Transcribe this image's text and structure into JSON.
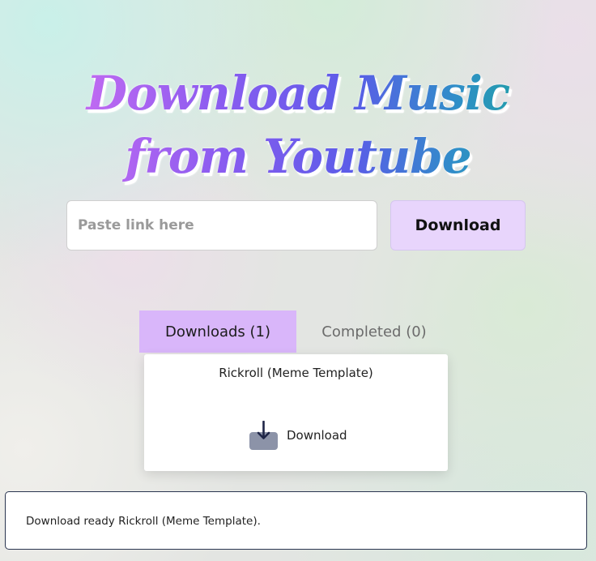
{
  "header": {
    "title": "Download Music from Youtube"
  },
  "search": {
    "placeholder": "Paste link here",
    "value": "",
    "button_label": "Download"
  },
  "tabs": [
    {
      "label": "Downloads (1)",
      "active": true
    },
    {
      "label": "Completed (0)",
      "active": false
    }
  ],
  "downloads": {
    "items": [
      {
        "title": "Rickroll (Meme Template)",
        "action_label": "Download",
        "icon": "download-icon"
      }
    ]
  },
  "status": {
    "message": "Download ready Rickroll (Meme Template)."
  },
  "colors": {
    "title_gradient": [
      "#d46ff2",
      "#8b5cf0",
      "#5b5ce8",
      "#2f8fc8",
      "#18a894"
    ],
    "button_bg": "#e8d5fc",
    "active_tab_bg": "#d9b6fa",
    "icon_tray": "#8c93a8",
    "icon_arrow": "#1e2547"
  }
}
